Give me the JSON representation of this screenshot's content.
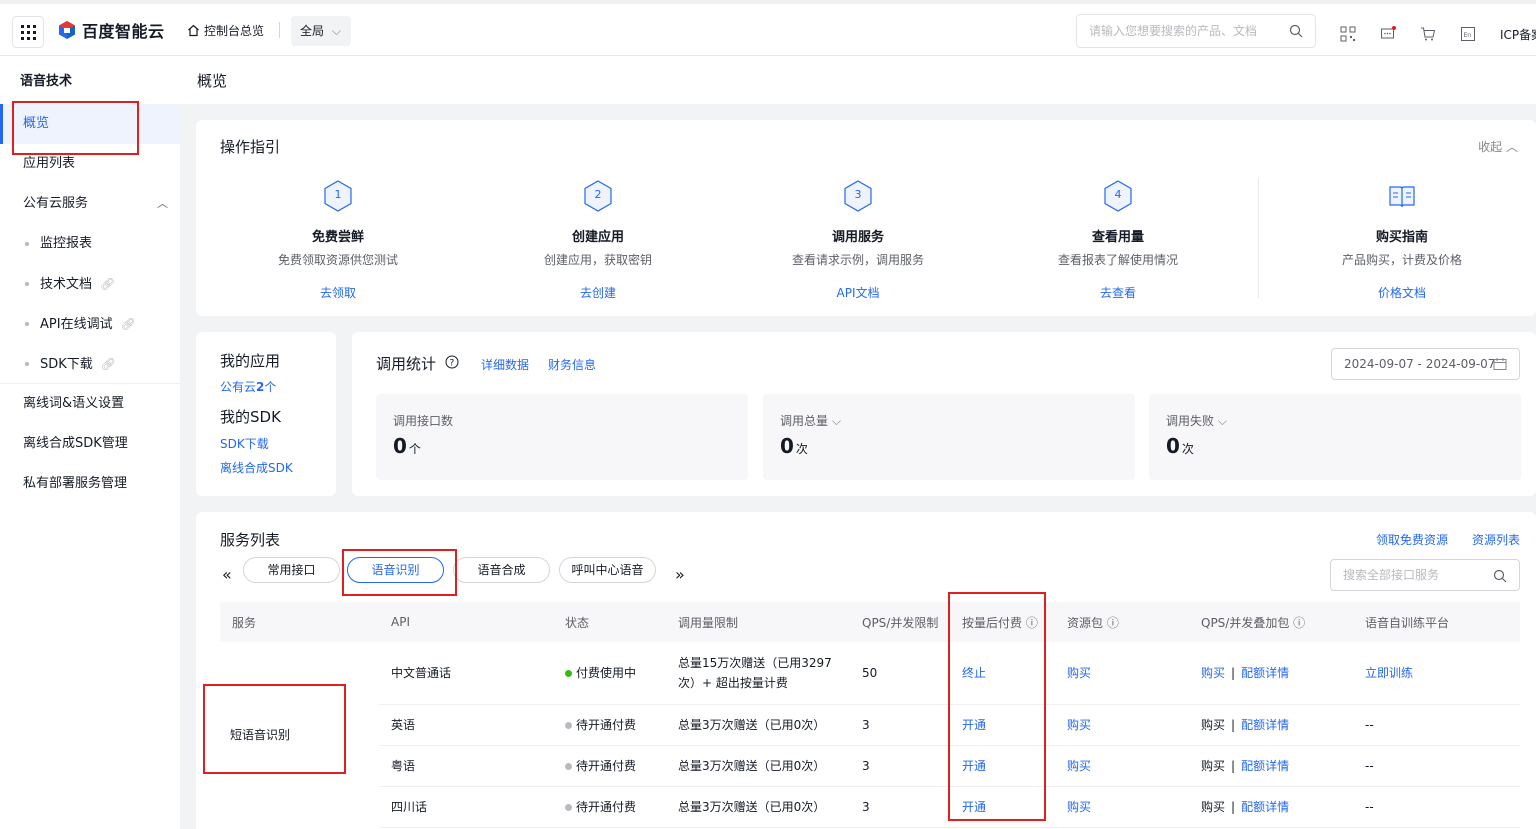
{
  "topbar": {
    "brand": "百度智能云",
    "home_label": "控制台总览",
    "region_label": "全局",
    "search_placeholder": "请输入您想要搜索的产品、文档",
    "icp_label": "ICP备案"
  },
  "sidebar": {
    "title": "语音技术",
    "items": [
      {
        "label": "概览"
      },
      {
        "label": "应用列表"
      },
      {
        "label": "公有云服务"
      },
      {
        "label": "监控报表"
      },
      {
        "label": "技术文档"
      },
      {
        "label": "API在线调试"
      },
      {
        "label": "SDK下载"
      },
      {
        "label": "离线词&语义设置"
      },
      {
        "label": "离线合成SDK管理"
      },
      {
        "label": "私有部署服务管理"
      }
    ]
  },
  "page": {
    "title": "概览"
  },
  "guide": {
    "title": "操作指引",
    "collapse_label": "收起",
    "steps": [
      {
        "num": "1",
        "title": "免费尝鲜",
        "desc": "免费领取资源供您测试",
        "link": "去领取"
      },
      {
        "num": "2",
        "title": "创建应用",
        "desc": "创建应用，获取密钥",
        "link": "去创建"
      },
      {
        "num": "3",
        "title": "调用服务",
        "desc": "查看请求示例，调用服务",
        "link": "API文档"
      },
      {
        "num": "4",
        "title": "查看用量",
        "desc": "查看报表了解使用情况",
        "link": "去查看"
      },
      {
        "num": "",
        "title": "购买指南",
        "desc": "产品购买，计费及价格",
        "link": "价格文档"
      }
    ]
  },
  "my": {
    "apps_title": "我的应用",
    "apps_link_prefix": "公有云",
    "apps_count": "2",
    "apps_link_suffix": "个",
    "sdk_title": "我的SDK",
    "sdk_links": [
      "SDK下载",
      "离线合成SDK"
    ]
  },
  "stats": {
    "title": "调用统计",
    "links": [
      "详细数据",
      "财务信息"
    ],
    "date_range": "2024-09-07 - 2024-09-07",
    "boxes": [
      {
        "label": "调用接口数",
        "value": "0",
        "unit": "个"
      },
      {
        "label": "调用总量",
        "value": "0",
        "unit": "次"
      },
      {
        "label": "调用失败",
        "value": "0",
        "unit": "次"
      }
    ]
  },
  "services": {
    "title": "服务列表",
    "links": [
      "领取免费资源",
      "资源列表"
    ],
    "tabs": [
      "常用接口",
      "语音识别",
      "语音合成",
      "呼叫中心语音"
    ],
    "search_placeholder": "搜索全部接口服务",
    "columns": [
      "服务",
      "API",
      "状态",
      "调用量限制",
      "QPS/并发限制",
      "按量后付费",
      "资源包",
      "QPS/并发叠加包",
      "语音自训练平台"
    ],
    "service_name": "短语音识别",
    "rows": [
      {
        "api": "中文普通话",
        "status": "付费使用中",
        "limit": "总量15万次赠送（已用3297次）+ 超出按量计费",
        "qps": "50",
        "postpaid": "终止",
        "pack": "购买",
        "qps_buy": "购买",
        "qps_detail": "配额详情",
        "train": "立即训练"
      },
      {
        "api": "英语",
        "status": "待开通付费",
        "limit": "总量3万次赠送（已用0次）",
        "qps": "3",
        "postpaid": "开通",
        "pack": "购买",
        "qps_buy": "购买",
        "qps_detail": "配额详情",
        "train": "--"
      },
      {
        "api": "粤语",
        "status": "待开通付费",
        "limit": "总量3万次赠送（已用0次）",
        "qps": "3",
        "postpaid": "开通",
        "pack": "购买",
        "qps_buy": "购买",
        "qps_detail": "配额详情",
        "train": "--"
      },
      {
        "api": "四川话",
        "status": "待开通付费",
        "limit": "总量3万次赠送（已用0次）",
        "qps": "3",
        "postpaid": "开通",
        "pack": "购买",
        "qps_buy": "购买",
        "qps_detail": "配额详情",
        "train": "--"
      }
    ]
  },
  "colors": {
    "accent": "#2468f2",
    "active_status": "#30bf13",
    "pending_status": "#b8babf",
    "annotation": "#e02020"
  }
}
